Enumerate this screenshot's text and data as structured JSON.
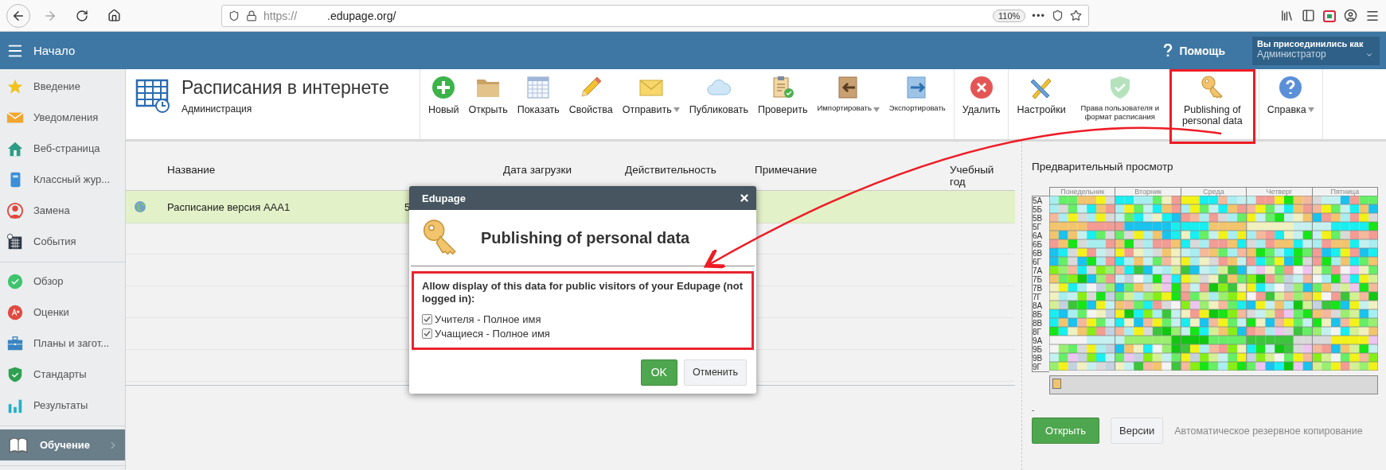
{
  "browser": {
    "url_scheme": "https://",
    "url_domain": ".edupage.org/",
    "zoom": "110%",
    "more": "•••"
  },
  "header": {
    "title": "Начало",
    "help": "Помощь",
    "login_caption": "Вы присоединились как",
    "login_role": "Администратор"
  },
  "sidebar": {
    "groups": [
      [
        {
          "label": "Введение",
          "selected": false
        },
        {
          "label": "Уведомления",
          "selected": false
        },
        {
          "label": "Веб-страница",
          "selected": false
        },
        {
          "label": "Классный жур...",
          "selected": false
        },
        {
          "label": "Замена",
          "selected": false
        },
        {
          "label": "События",
          "selected": false
        }
      ],
      [
        {
          "label": "Обзор",
          "selected": false
        },
        {
          "label": "Оценки",
          "selected": false
        },
        {
          "label": "Планы и загот...",
          "selected": false
        },
        {
          "label": "Стандарты",
          "selected": false
        },
        {
          "label": "Результаты",
          "selected": false
        }
      ],
      [
        {
          "label": "Обучение",
          "selected": true
        }
      ]
    ]
  },
  "toolbar": {
    "title": "Расписания в интернете",
    "subtitle": "Администрация",
    "groups": [
      [
        {
          "label": "Новый",
          "kind": "normal",
          "dropdown": false,
          "disabled": false,
          "highlighted": false
        },
        {
          "label": "Открыть",
          "kind": "normal",
          "dropdown": false,
          "disabled": false,
          "highlighted": false
        },
        {
          "label": "Показать",
          "kind": "normal",
          "dropdown": false,
          "disabled": false,
          "highlighted": false
        },
        {
          "label": "Свойства",
          "kind": "normal",
          "dropdown": false,
          "disabled": false,
          "highlighted": false
        },
        {
          "label": "Отправить",
          "kind": "normal",
          "dropdown": true,
          "disabled": false,
          "highlighted": false
        },
        {
          "label": "Публиковать",
          "kind": "normal",
          "dropdown": false,
          "disabled": false,
          "highlighted": false
        },
        {
          "label": "Проверить",
          "kind": "normal",
          "dropdown": false,
          "disabled": false,
          "highlighted": false
        },
        {
          "label": "Импортировать",
          "kind": "small",
          "dropdown": true,
          "disabled": false,
          "highlighted": false
        },
        {
          "label": "Экспортировать",
          "kind": "small",
          "dropdown": false,
          "disabled": false,
          "highlighted": false
        }
      ],
      [
        {
          "label": "Удалить",
          "kind": "normal",
          "dropdown": false,
          "disabled": false,
          "highlighted": false
        }
      ],
      [
        {
          "label": "Настройки",
          "kind": "normal",
          "dropdown": false,
          "disabled": false,
          "highlighted": false
        },
        {
          "label": "Права пользователя и формат расписания",
          "kind": "small",
          "dropdown": false,
          "disabled": true,
          "highlighted": false
        },
        {
          "label": "Publishing of personal data",
          "kind": "normal",
          "dropdown": false,
          "disabled": false,
          "highlighted": true
        }
      ],
      [
        {
          "label": "Справка",
          "kind": "normal",
          "dropdown": true,
          "disabled": false,
          "highlighted": false
        }
      ]
    ]
  },
  "table": {
    "columns": [
      "Название",
      "Дата загрузки",
      "Действительность",
      "Примечание",
      "Учебный год"
    ],
    "rows": [
      {
        "name": "Расписание версия AAA1",
        "column_3": "5",
        "selected": true
      }
    ]
  },
  "dialog": {
    "title": "Edupage",
    "heading": "Publishing of personal data",
    "prompt": "Allow display of this data for public visitors of your Edupage (not logged in):",
    "highlighted": true,
    "options": [
      {
        "label": "Учителя - Полное имя",
        "checked": true
      },
      {
        "label": "Учащиеся - Полное имя",
        "checked": true
      }
    ],
    "buttons": [
      "OK",
      "Отменить"
    ]
  },
  "preview": {
    "title": "Предварительный просмотр",
    "days": [
      "Понедельник",
      "Вторник",
      "Среда",
      "Четверг",
      "Пятница"
    ],
    "classes": [
      "5А",
      "5Б",
      "5В",
      "5Г",
      "6А",
      "6Б",
      "6В",
      "6Г",
      "7А",
      "7Б",
      "7В",
      "7Г",
      "8А",
      "8Б",
      "8В",
      "8Г",
      "9А",
      "9Б",
      "9В",
      "9Г"
    ],
    "note": "-",
    "buttons": [
      "Открыть",
      "Версии"
    ],
    "backup": "Автоматическое резервное копирование"
  }
}
